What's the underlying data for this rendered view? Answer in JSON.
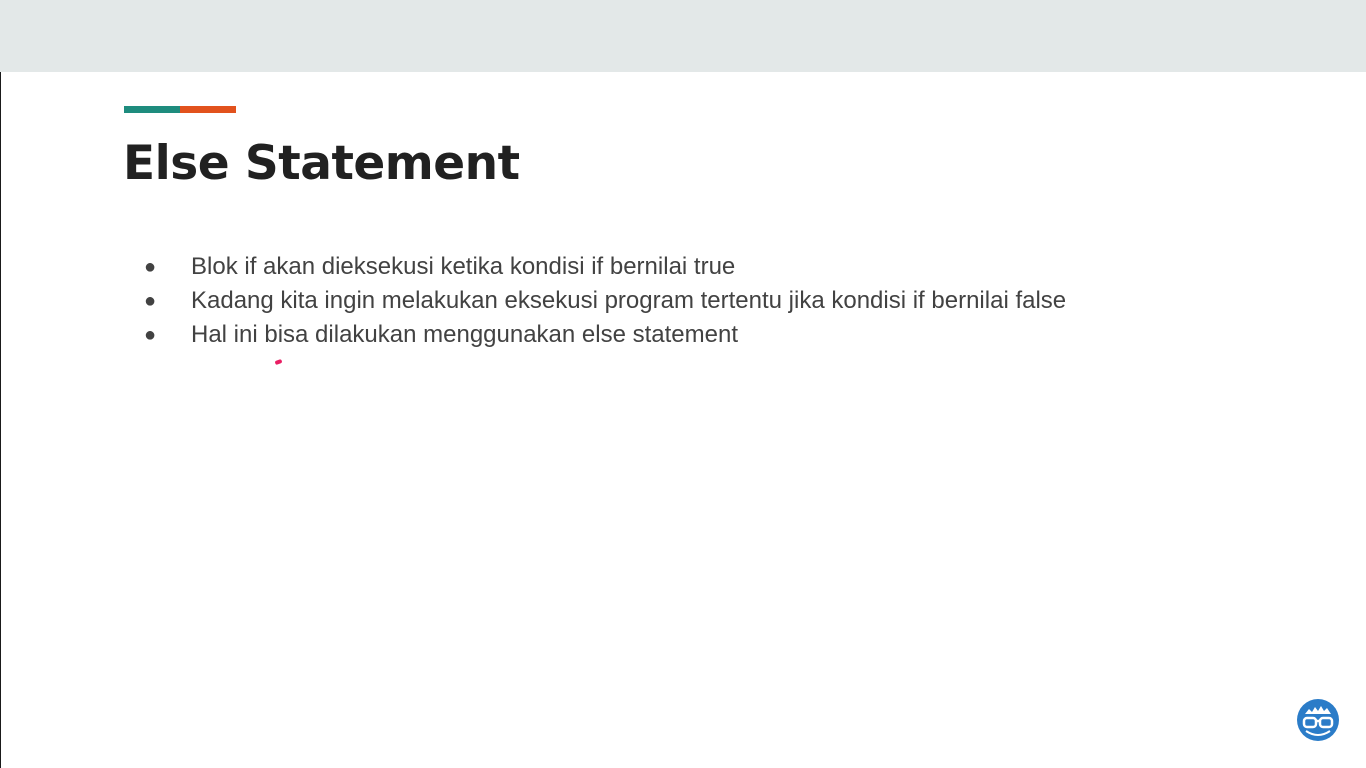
{
  "colors": {
    "accent_teal": "#1e8c7e",
    "accent_orange": "#e2521d",
    "logo_blue": "#2b7cc8"
  },
  "slide": {
    "title": "Else Statement",
    "bullets": [
      "Blok if akan dieksekusi ketika kondisi if bernilai true",
      "Kadang kita ingin melakukan eksekusi program tertentu jika kondisi if bernilai false",
      "Hal ini bisa dilakukan menggunakan else statement"
    ],
    "bullet_glyph": "●"
  },
  "logo": {
    "icon": "glasses-face-icon"
  }
}
